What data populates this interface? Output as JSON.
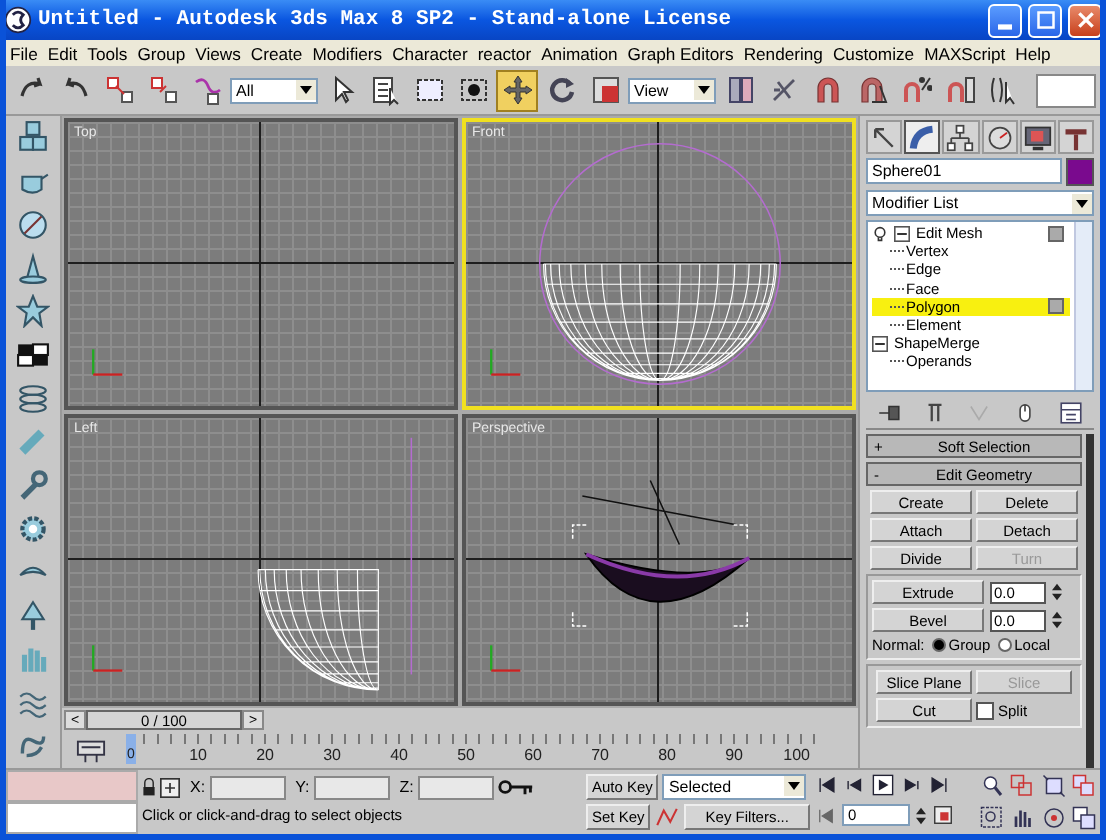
{
  "window": {
    "title": "Untitled  - Autodesk 3ds Max 8 SP2  - Stand-alone License"
  },
  "menu": [
    "File",
    "Edit",
    "Tools",
    "Group",
    "Views",
    "Create",
    "Modifiers",
    "Character",
    "reactor",
    "Animation",
    "Graph Editors",
    "Rendering",
    "Customize",
    "MAXScript",
    "Help"
  ],
  "toolbar": {
    "selection_filter": "All",
    "reference_coordinate": "View",
    "tools": [
      {
        "selected": false
      },
      {
        "selected": false
      },
      {
        "selected": false
      },
      {
        "selected": false
      },
      {
        "selected": false
      },
      {
        "selected": false
      },
      {
        "selected": false
      },
      {
        "selected": false
      },
      {
        "selected": false
      },
      {
        "selected": true
      },
      {
        "selected": false
      },
      {
        "selected": false
      },
      {
        "selected": false
      },
      {
        "selected": false
      },
      {
        "selected": false
      },
      {
        "selected": false
      },
      {
        "selected": false
      },
      {
        "selected": false
      },
      {
        "selected": false
      }
    ]
  },
  "viewports": [
    {
      "label": "Top",
      "selected": false,
      "kind": "empty"
    },
    {
      "label": "Front",
      "selected": true,
      "kind": "front"
    },
    {
      "label": "Left",
      "selected": false,
      "kind": "left"
    },
    {
      "label": "Perspective",
      "selected": false,
      "kind": "perspective"
    }
  ],
  "time_slider": {
    "prev": "<",
    "position": "0 / 100",
    "next": ">"
  },
  "track_bar": {
    "current_frame": "0",
    "labels": [
      "10",
      "20",
      "30",
      "40",
      "50",
      "60",
      "70",
      "80",
      "90",
      "100"
    ]
  },
  "command_panel": {
    "tabs": [
      {
        "selected": false
      },
      {
        "selected": true
      },
      {
        "selected": false
      },
      {
        "selected": false
      },
      {
        "selected": false
      },
      {
        "selected": false
      }
    ],
    "object_name": "Sphere01",
    "modifier_list": "Modifier List",
    "stack": [
      {
        "label": "Edit Mesh",
        "expanded": true,
        "children": [
          {
            "label": "Vertex",
            "selected": false
          },
          {
            "label": "Edge",
            "selected": false
          },
          {
            "label": "Face",
            "selected": false
          },
          {
            "label": "Polygon",
            "selected": true
          },
          {
            "label": "Element",
            "selected": false
          }
        ]
      },
      {
        "label": "ShapeMerge",
        "expanded": true,
        "children": [
          {
            "label": "Operands",
            "selected": false
          }
        ]
      }
    ],
    "rollouts": [
      {
        "sign": "+",
        "title": "Soft Selection"
      },
      {
        "sign": "-",
        "title": "Edit Geometry"
      }
    ],
    "edit_geometry": {
      "buttons": [
        {
          "label": "Create",
          "disabled": false
        },
        {
          "label": "Delete",
          "disabled": false
        },
        {
          "label": "Attach",
          "disabled": false
        },
        {
          "label": "Detach",
          "disabled": false
        },
        {
          "label": "Divide",
          "disabled": false
        },
        {
          "label": "Turn",
          "disabled": true
        }
      ],
      "spinners": [
        {
          "label": "Extrude",
          "value": "0.0"
        },
        {
          "label": "Bevel",
          "value": "0.0"
        }
      ],
      "normal": {
        "label": "Normal:",
        "options": [
          {
            "label": "Group",
            "selected": true
          },
          {
            "label": "Local",
            "selected": false
          }
        ]
      },
      "slice_buttons": [
        {
          "label": "Slice Plane",
          "disabled": false
        },
        {
          "label": "Slice",
          "disabled": true
        }
      ],
      "cut": "Cut",
      "split": {
        "label": "Split",
        "checked": false
      }
    }
  },
  "status": {
    "x_label": "X:",
    "y_label": "Y:",
    "z_label": "Z:",
    "prompt": "Click or click-and-drag to select objects"
  },
  "animation": {
    "auto_key": "Auto Key",
    "key_mode": "Selected",
    "set_key": "Set Key",
    "key_filters": "Key Filters...",
    "frame": "0"
  }
}
